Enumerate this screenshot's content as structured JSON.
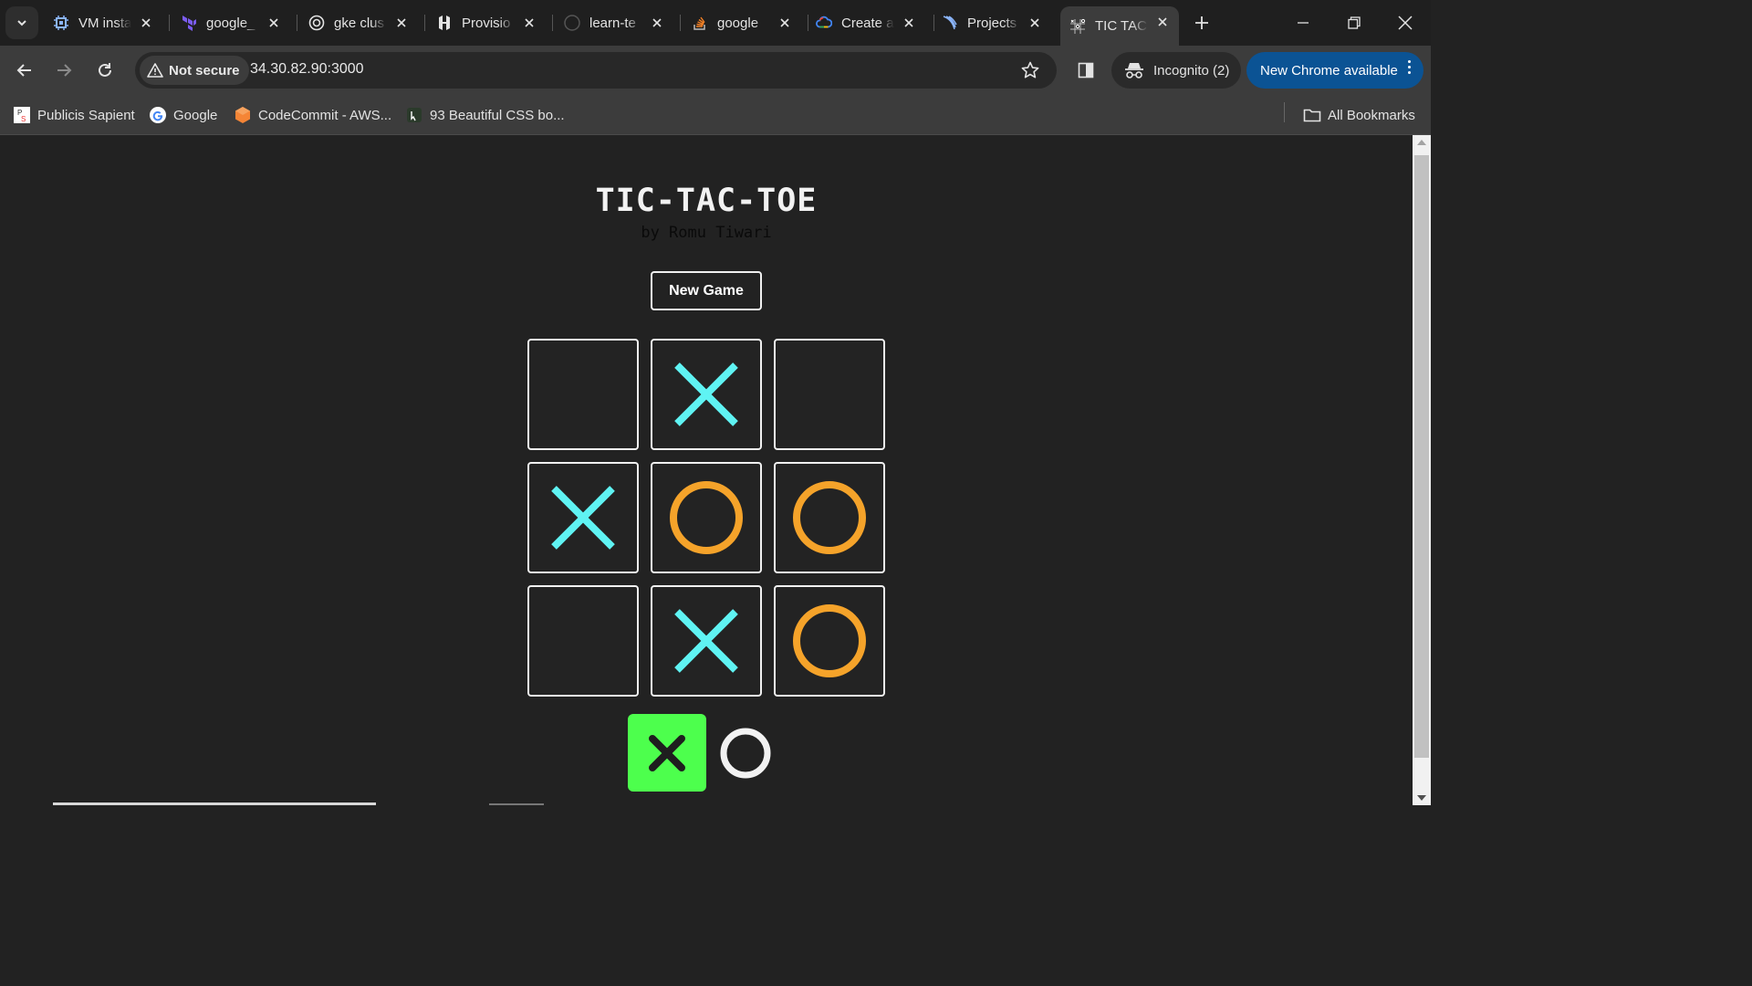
{
  "browser": {
    "tabs": [
      {
        "title": "VM insta",
        "icon": "compute-engine-icon"
      },
      {
        "title": "google_",
        "icon": "terraform-icon"
      },
      {
        "title": "gke clus",
        "icon": "github-copilot-icon"
      },
      {
        "title": "Provisio",
        "icon": "hashicorp-icon"
      },
      {
        "title": "learn-te",
        "icon": "github-icon"
      },
      {
        "title": "google",
        "icon": "stackoverflow-icon"
      },
      {
        "title": "Create a",
        "icon": "google-cloud-icon"
      },
      {
        "title": "Projects",
        "icon": "projects-icon"
      },
      {
        "title": "TIC TAC",
        "icon": "tic-tac-toe-icon",
        "active": true
      }
    ],
    "security_label": "Not secure",
    "url": "34.30.82.90:3000",
    "incognito_label": "Incognito (2)",
    "update_label": "New Chrome available",
    "bookmarks": [
      {
        "label": "Publicis Sapient"
      },
      {
        "label": "Google"
      },
      {
        "label": "CodeCommit - AWS..."
      },
      {
        "label": "93 Beautiful CSS bo..."
      }
    ],
    "all_bookmarks_label": "All Bookmarks"
  },
  "game": {
    "title": "TIC-TAC-TOE",
    "subtitle": "by Romu Tiwari",
    "new_game_label": "New Game",
    "board": [
      "",
      "X",
      "",
      "X",
      "O",
      "O",
      "",
      "X",
      "O"
    ],
    "current_turn": "X",
    "colors": {
      "x": "#5ff3f3",
      "o": "#f5a32a",
      "turn_highlight": "#4dff4d",
      "background": "#222222"
    }
  }
}
